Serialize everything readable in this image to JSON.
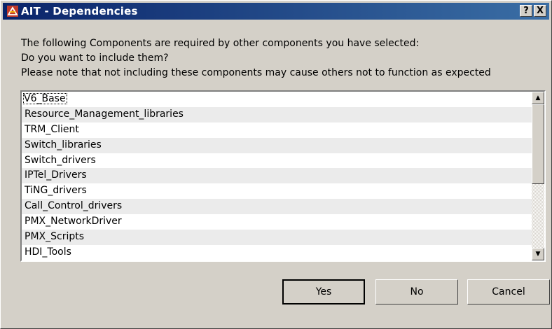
{
  "window": {
    "title": "AIT - Dependencies",
    "help_label": "?",
    "close_label": "X"
  },
  "message": {
    "line1": "The following Components are required by other components you have selected:",
    "line2": "Do you want to include them?",
    "line3": "Please note that not including these components may cause others not to function as expected"
  },
  "components": [
    "V6_Base",
    "Resource_Management_libraries",
    "TRM_Client",
    "Switch_libraries",
    "Switch_drivers",
    "IPTel_Drivers",
    "TiNG_drivers",
    "Call_Control_drivers",
    "PMX_NetworkDriver",
    "PMX_Scripts",
    "HDI_Tools"
  ],
  "scrollbar": {
    "up_glyph": "▲",
    "down_glyph": "▼"
  },
  "buttons": {
    "yes": "Yes",
    "no": "No",
    "cancel": "Cancel"
  }
}
